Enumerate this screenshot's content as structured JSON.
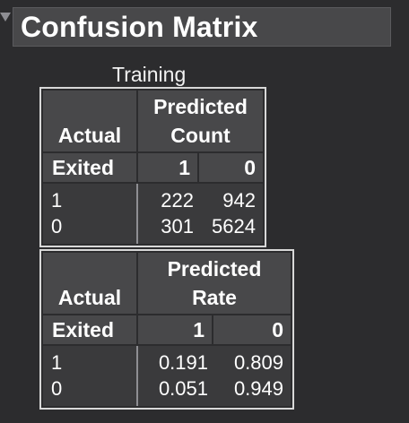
{
  "section": {
    "title": "Confusion Matrix"
  },
  "caption": "Training",
  "count_table": {
    "actual_header": "Actual",
    "predicted_header_1": "Predicted",
    "predicted_header_2": "Count",
    "row_header": "Exited",
    "col_labels": [
      "1",
      "0"
    ],
    "rows": [
      {
        "label": "1",
        "values": [
          "222",
          "942"
        ]
      },
      {
        "label": "0",
        "values": [
          "301",
          "5624"
        ]
      }
    ]
  },
  "rate_table": {
    "actual_header": "Actual",
    "predicted_header_1": "Predicted",
    "predicted_header_2": "Rate",
    "row_header": "Exited",
    "col_labels": [
      "1",
      "0"
    ],
    "rows": [
      {
        "label": "1",
        "values": [
          "0.191",
          "0.809"
        ]
      },
      {
        "label": "0",
        "values": [
          "0.051",
          "0.949"
        ]
      }
    ]
  }
}
